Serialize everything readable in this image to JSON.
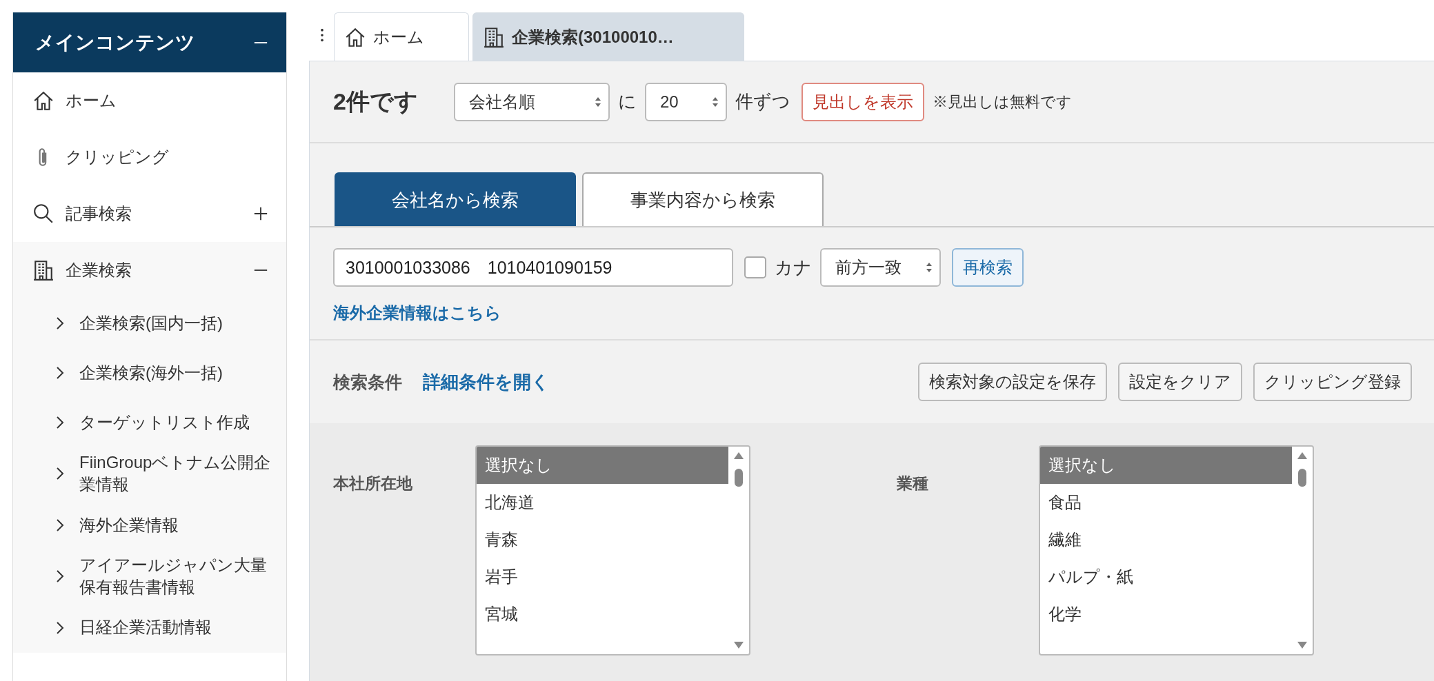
{
  "sidebar": {
    "title": "メインコンテンツ",
    "expanded": true,
    "items": [
      {
        "label": "ホーム",
        "kind": "home"
      },
      {
        "label": "クリッピング",
        "kind": "clip"
      },
      {
        "label": "記事検索",
        "kind": "search",
        "expanded": false
      },
      {
        "label": "企業検索",
        "kind": "building",
        "expanded": true,
        "children": [
          {
            "label": "企業検索(国内一括)"
          },
          {
            "label": "企業検索(海外一括)"
          },
          {
            "label": "ターゲットリスト作成"
          },
          {
            "label": "FiinGroupベトナム公開企業情報"
          },
          {
            "label": "海外企業情報"
          },
          {
            "label": "アイアールジャパン大量保有報告書情報"
          },
          {
            "label": "日経企業活動情報"
          }
        ]
      }
    ]
  },
  "tabs": [
    {
      "label": "ホーム",
      "kind": "home",
      "selected": false
    },
    {
      "label": "企業検索(30100010…",
      "kind": "building",
      "selected": true
    }
  ],
  "toolbar": {
    "count": "2件です",
    "sort": "会社名順",
    "per_label": "に",
    "per_page": "20",
    "per_suffix": "件ずつ",
    "headline_button": "見出しを表示",
    "note": "※見出しは無料です"
  },
  "search_tabs": [
    {
      "label": "会社名から検索",
      "selected": true
    },
    {
      "label": "事業内容から検索",
      "selected": false
    }
  ],
  "search": {
    "value": "3010001033086　1010401090159",
    "kana_label": "カナ",
    "kana_checked": false,
    "match": "前方一致",
    "button": "再検索",
    "link": "海外企業情報はこちら"
  },
  "conditions": {
    "title": "検索条件",
    "toggle": "詳細条件を開く",
    "buttons": [
      "検索対象の設定を保存",
      "設定をクリア",
      "クリッピング登録"
    ]
  },
  "filters": [
    {
      "label": "本社所在地",
      "options": [
        {
          "label": "選択なし",
          "selected": true
        },
        {
          "label": "北海道",
          "selected": false
        },
        {
          "label": "青森",
          "selected": false
        },
        {
          "label": "岩手",
          "selected": false
        },
        {
          "label": "宮城",
          "selected": false
        }
      ]
    },
    {
      "label": "業種",
      "options": [
        {
          "label": "選択なし",
          "selected": true
        },
        {
          "label": "食品",
          "selected": false
        },
        {
          "label": "繊維",
          "selected": false
        },
        {
          "label": "パルプ・紙",
          "selected": false
        },
        {
          "label": "化学",
          "selected": false
        }
      ]
    }
  ]
}
